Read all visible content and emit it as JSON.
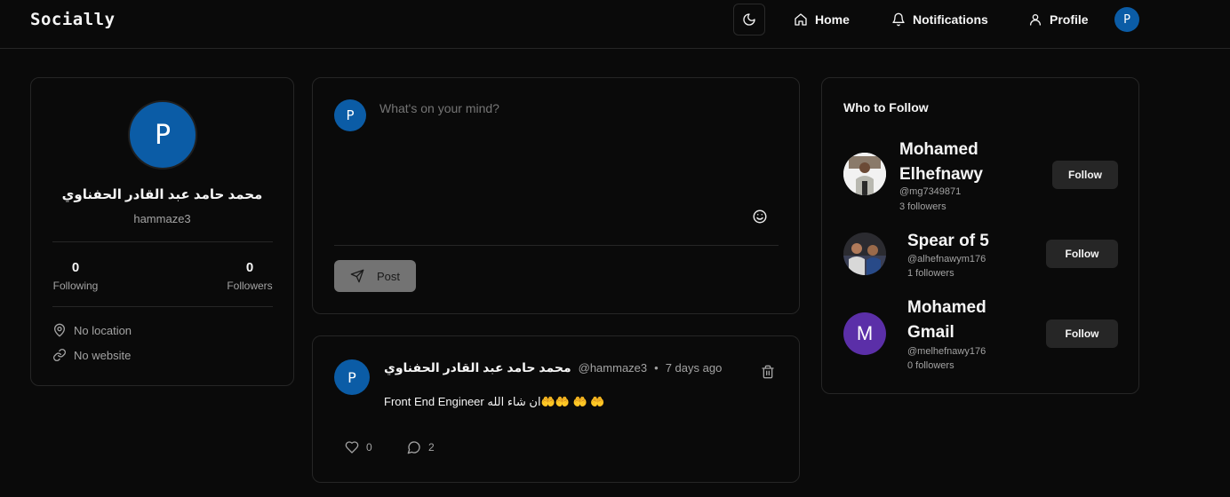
{
  "header": {
    "brand": "Socially",
    "nav": {
      "home": "Home",
      "notifications": "Notifications",
      "profile": "Profile"
    },
    "avatar_letter": "P"
  },
  "profile_card": {
    "avatar_letter": "P",
    "name": "محمد حامد عبد القادر الحفناوي",
    "username": "hammaze3",
    "following_count": "0",
    "following_label": "Following",
    "followers_count": "0",
    "followers_label": "Followers",
    "location": "No location",
    "website": "No website"
  },
  "composer": {
    "avatar_letter": "P",
    "placeholder": "What's on your mind?",
    "post_label": "Post"
  },
  "post": {
    "avatar_letter": "P",
    "author": "محمد حامد عبد القادر الحفناوي",
    "handle": "@hammaze3",
    "separator": "•",
    "time": "7 days ago",
    "content": "Front End Engineer ان شاء الله🤲🤲 🤲 🤲",
    "likes": "0",
    "comments": "2"
  },
  "who_to_follow": {
    "title": "Who to Follow",
    "users": [
      {
        "name_line1": "Mohamed",
        "name_line2": "Elhefnawy",
        "handle": "@mg7349871",
        "followers": "3 followers",
        "button": "Follow"
      },
      {
        "name_line1": "Spear of 5",
        "name_line2": "",
        "handle": "@alhefnawym176",
        "followers": "1 followers",
        "button": "Follow"
      },
      {
        "name_line1": "Mohamed",
        "name_line2": "Gmail",
        "handle": "@melhefnawy176",
        "followers": "0 followers",
        "button": "Follow",
        "avatar_letter": "M"
      }
    ]
  },
  "colors": {
    "background": "#0a0a0a",
    "border": "#262626",
    "avatar_blue": "#0b5ca6",
    "avatar_purple": "#5b2fa8"
  }
}
